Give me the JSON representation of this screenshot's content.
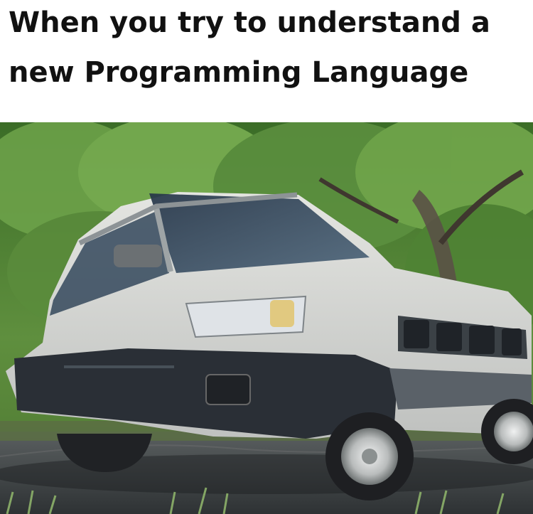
{
  "caption": {
    "line1": "When you try to understand a",
    "line2": "new Programming Language"
  },
  "photo": {
    "subject": "car-with-van-rear",
    "icon": "car-photo-icon"
  },
  "colors": {
    "background": "#ffffff",
    "text": "#111111",
    "foliage_dark": "#2f5a1f",
    "foliage_light": "#6fa44b",
    "car_body": "#d8d8d5",
    "car_trim": "#2a2f36",
    "tire": "#1e1f22",
    "road": "#3f4346"
  }
}
